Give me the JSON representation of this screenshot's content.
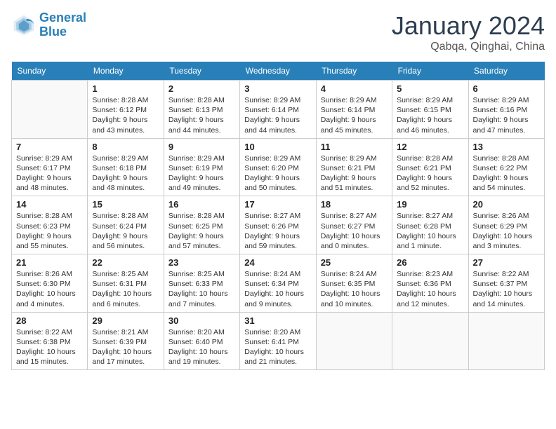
{
  "header": {
    "logo_line1": "General",
    "logo_line2": "Blue",
    "month": "January 2024",
    "location": "Qabqa, Qinghai, China"
  },
  "days_of_week": [
    "Sunday",
    "Monday",
    "Tuesday",
    "Wednesday",
    "Thursday",
    "Friday",
    "Saturday"
  ],
  "weeks": [
    [
      {
        "day": "",
        "info": ""
      },
      {
        "day": "1",
        "info": "Sunrise: 8:28 AM\nSunset: 6:12 PM\nDaylight: 9 hours\nand 43 minutes."
      },
      {
        "day": "2",
        "info": "Sunrise: 8:28 AM\nSunset: 6:13 PM\nDaylight: 9 hours\nand 44 minutes."
      },
      {
        "day": "3",
        "info": "Sunrise: 8:29 AM\nSunset: 6:14 PM\nDaylight: 9 hours\nand 44 minutes."
      },
      {
        "day": "4",
        "info": "Sunrise: 8:29 AM\nSunset: 6:14 PM\nDaylight: 9 hours\nand 45 minutes."
      },
      {
        "day": "5",
        "info": "Sunrise: 8:29 AM\nSunset: 6:15 PM\nDaylight: 9 hours\nand 46 minutes."
      },
      {
        "day": "6",
        "info": "Sunrise: 8:29 AM\nSunset: 6:16 PM\nDaylight: 9 hours\nand 47 minutes."
      }
    ],
    [
      {
        "day": "7",
        "info": "Sunrise: 8:29 AM\nSunset: 6:17 PM\nDaylight: 9 hours\nand 48 minutes."
      },
      {
        "day": "8",
        "info": "Sunrise: 8:29 AM\nSunset: 6:18 PM\nDaylight: 9 hours\nand 48 minutes."
      },
      {
        "day": "9",
        "info": "Sunrise: 8:29 AM\nSunset: 6:19 PM\nDaylight: 9 hours\nand 49 minutes."
      },
      {
        "day": "10",
        "info": "Sunrise: 8:29 AM\nSunset: 6:20 PM\nDaylight: 9 hours\nand 50 minutes."
      },
      {
        "day": "11",
        "info": "Sunrise: 8:29 AM\nSunset: 6:21 PM\nDaylight: 9 hours\nand 51 minutes."
      },
      {
        "day": "12",
        "info": "Sunrise: 8:28 AM\nSunset: 6:21 PM\nDaylight: 9 hours\nand 52 minutes."
      },
      {
        "day": "13",
        "info": "Sunrise: 8:28 AM\nSunset: 6:22 PM\nDaylight: 9 hours\nand 54 minutes."
      }
    ],
    [
      {
        "day": "14",
        "info": "Sunrise: 8:28 AM\nSunset: 6:23 PM\nDaylight: 9 hours\nand 55 minutes."
      },
      {
        "day": "15",
        "info": "Sunrise: 8:28 AM\nSunset: 6:24 PM\nDaylight: 9 hours\nand 56 minutes."
      },
      {
        "day": "16",
        "info": "Sunrise: 8:28 AM\nSunset: 6:25 PM\nDaylight: 9 hours\nand 57 minutes."
      },
      {
        "day": "17",
        "info": "Sunrise: 8:27 AM\nSunset: 6:26 PM\nDaylight: 9 hours\nand 59 minutes."
      },
      {
        "day": "18",
        "info": "Sunrise: 8:27 AM\nSunset: 6:27 PM\nDaylight: 10 hours\nand 0 minutes."
      },
      {
        "day": "19",
        "info": "Sunrise: 8:27 AM\nSunset: 6:28 PM\nDaylight: 10 hours\nand 1 minute."
      },
      {
        "day": "20",
        "info": "Sunrise: 8:26 AM\nSunset: 6:29 PM\nDaylight: 10 hours\nand 3 minutes."
      }
    ],
    [
      {
        "day": "21",
        "info": "Sunrise: 8:26 AM\nSunset: 6:30 PM\nDaylight: 10 hours\nand 4 minutes."
      },
      {
        "day": "22",
        "info": "Sunrise: 8:25 AM\nSunset: 6:31 PM\nDaylight: 10 hours\nand 6 minutes."
      },
      {
        "day": "23",
        "info": "Sunrise: 8:25 AM\nSunset: 6:33 PM\nDaylight: 10 hours\nand 7 minutes."
      },
      {
        "day": "24",
        "info": "Sunrise: 8:24 AM\nSunset: 6:34 PM\nDaylight: 10 hours\nand 9 minutes."
      },
      {
        "day": "25",
        "info": "Sunrise: 8:24 AM\nSunset: 6:35 PM\nDaylight: 10 hours\nand 10 minutes."
      },
      {
        "day": "26",
        "info": "Sunrise: 8:23 AM\nSunset: 6:36 PM\nDaylight: 10 hours\nand 12 minutes."
      },
      {
        "day": "27",
        "info": "Sunrise: 8:22 AM\nSunset: 6:37 PM\nDaylight: 10 hours\nand 14 minutes."
      }
    ],
    [
      {
        "day": "28",
        "info": "Sunrise: 8:22 AM\nSunset: 6:38 PM\nDaylight: 10 hours\nand 15 minutes."
      },
      {
        "day": "29",
        "info": "Sunrise: 8:21 AM\nSunset: 6:39 PM\nDaylight: 10 hours\nand 17 minutes."
      },
      {
        "day": "30",
        "info": "Sunrise: 8:20 AM\nSunset: 6:40 PM\nDaylight: 10 hours\nand 19 minutes."
      },
      {
        "day": "31",
        "info": "Sunrise: 8:20 AM\nSunset: 6:41 PM\nDaylight: 10 hours\nand 21 minutes."
      },
      {
        "day": "",
        "info": ""
      },
      {
        "day": "",
        "info": ""
      },
      {
        "day": "",
        "info": ""
      }
    ]
  ]
}
